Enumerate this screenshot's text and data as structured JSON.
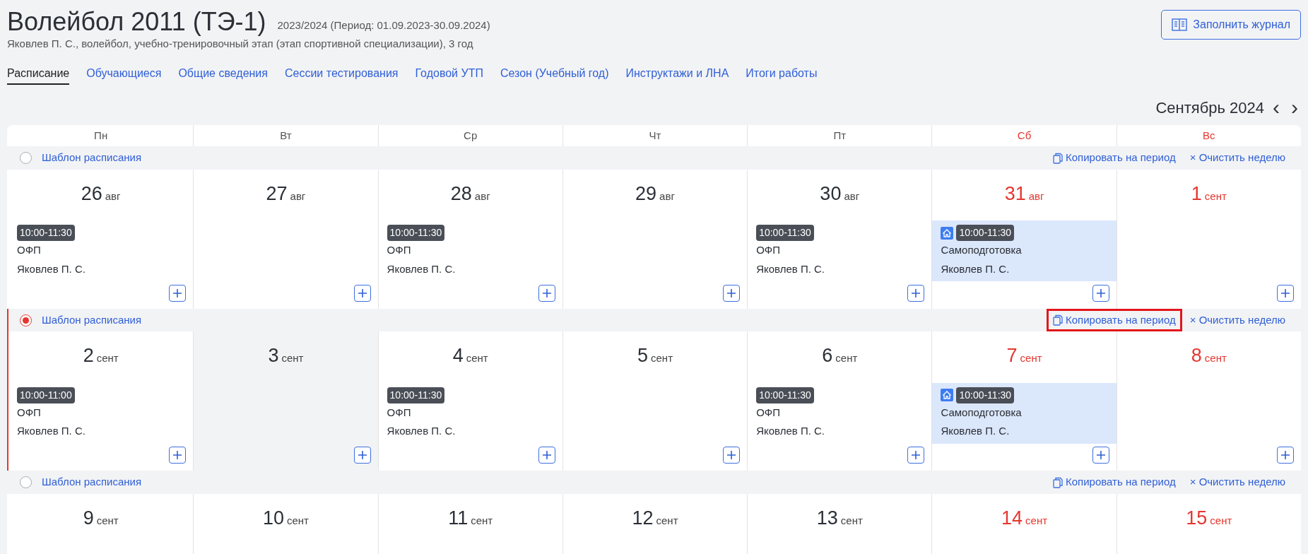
{
  "header": {
    "title": "Волейбол 2011 (ТЭ-1)",
    "period": "2023/2024 (Период: 01.09.2023-30.09.2024)",
    "subtitle": "Яковлев П. С., волейбол, учебно-тренировочный этап (этап спортивной специализации), 3 год",
    "journal_button": "Заполнить журнал"
  },
  "tabs": [
    {
      "label": "Расписание",
      "selected": true
    },
    {
      "label": "Обучающиеся",
      "selected": false
    },
    {
      "label": "Общие сведения",
      "selected": false
    },
    {
      "label": "Сессии тестирования",
      "selected": false
    },
    {
      "label": "Годовой УТП",
      "selected": false
    },
    {
      "label": "Сезон (Учебный год)",
      "selected": false
    },
    {
      "label": "Инструктажи и ЛНА",
      "selected": false
    },
    {
      "label": "Итоги работы",
      "selected": false
    }
  ],
  "month": {
    "label": "Сентябрь 2024",
    "prev": "‹",
    "next": "›"
  },
  "weekdays": [
    {
      "label": "Пн",
      "weekend": false
    },
    {
      "label": "Вт",
      "weekend": false
    },
    {
      "label": "Ср",
      "weekend": false
    },
    {
      "label": "Чт",
      "weekend": false
    },
    {
      "label": "Пт",
      "weekend": false
    },
    {
      "label": "Сб",
      "weekend": true
    },
    {
      "label": "Вс",
      "weekend": true
    }
  ],
  "weeks": [
    {
      "template": "Шаблон расписания",
      "selected": false,
      "copy": "Копировать на период",
      "copy_highlighted": false,
      "clear": "× Очистить неделю",
      "days": [
        {
          "day": "26",
          "month": "авг",
          "weekend": false,
          "selected": false,
          "events": [
            {
              "kind": "regular",
              "time": "10:00-11:30",
              "title": "ОФП",
              "coach": "Яковлев П. С."
            }
          ]
        },
        {
          "day": "27",
          "month": "авг",
          "weekend": false,
          "selected": false
        },
        {
          "day": "28",
          "month": "авг",
          "weekend": false,
          "selected": false,
          "events": [
            {
              "kind": "regular",
              "time": "10:00-11:30",
              "title": "ОФП",
              "coach": "Яковлев П. С."
            }
          ]
        },
        {
          "day": "29",
          "month": "авг",
          "weekend": false,
          "selected": false
        },
        {
          "day": "30",
          "month": "авг",
          "weekend": false,
          "selected": false,
          "events": [
            {
              "kind": "regular",
              "time": "10:00-11:30",
              "title": "ОФП",
              "coach": "Яковлев П. С."
            }
          ]
        },
        {
          "day": "31",
          "month": "авг",
          "weekend": true,
          "selected": false,
          "events": [
            {
              "kind": "home",
              "time": "10:00-11:30",
              "title": "Самоподготовка",
              "coach": "Яковлев П. С."
            }
          ]
        },
        {
          "day": "1",
          "month": "сент",
          "weekend": true,
          "selected": false
        }
      ]
    },
    {
      "template": "Шаблон расписания",
      "selected": true,
      "copy": "Копировать на период",
      "copy_highlighted": true,
      "clear": "× Очистить неделю",
      "days": [
        {
          "day": "2",
          "month": "сент",
          "weekend": false,
          "selected": false,
          "events": [
            {
              "kind": "regular",
              "time": "10:00-11:00",
              "title": "ОФП",
              "coach": "Яковлев П. С."
            }
          ]
        },
        {
          "day": "3",
          "month": "сент",
          "weekend": false,
          "selected": true
        },
        {
          "day": "4",
          "month": "сент",
          "weekend": false,
          "selected": false,
          "events": [
            {
              "kind": "regular",
              "time": "10:00-11:30",
              "title": "ОФП",
              "coach": "Яковлев П. С."
            }
          ]
        },
        {
          "day": "5",
          "month": "сент",
          "weekend": false,
          "selected": false
        },
        {
          "day": "6",
          "month": "сент",
          "weekend": false,
          "selected": false,
          "events": [
            {
              "kind": "regular",
              "time": "10:00-11:30",
              "title": "ОФП",
              "coach": "Яковлев П. С."
            }
          ]
        },
        {
          "day": "7",
          "month": "сент",
          "weekend": true,
          "selected": false,
          "events": [
            {
              "kind": "home",
              "time": "10:00-11:30",
              "title": "Самоподготовка",
              "coach": "Яковлев П. С."
            }
          ]
        },
        {
          "day": "8",
          "month": "сент",
          "weekend": true,
          "selected": false
        }
      ]
    },
    {
      "template": "Шаблон расписания",
      "selected": false,
      "copy": "Копировать на период",
      "copy_highlighted": false,
      "clear": "× Очистить неделю",
      "days": [
        {
          "day": "9",
          "month": "сент",
          "weekend": false,
          "selected": false,
          "add_button": false
        },
        {
          "day": "10",
          "month": "сент",
          "weekend": false,
          "selected": false,
          "add_button": false
        },
        {
          "day": "11",
          "month": "сент",
          "weekend": false,
          "selected": false,
          "add_button": false
        },
        {
          "day": "12",
          "month": "сент",
          "weekend": false,
          "selected": false,
          "add_button": false
        },
        {
          "day": "13",
          "month": "сент",
          "weekend": false,
          "selected": false,
          "add_button": false
        },
        {
          "day": "14",
          "month": "сент",
          "weekend": true,
          "selected": false,
          "add_button": false
        },
        {
          "day": "15",
          "month": "сент",
          "weekend": true,
          "selected": false,
          "add_button": false
        }
      ]
    }
  ]
}
